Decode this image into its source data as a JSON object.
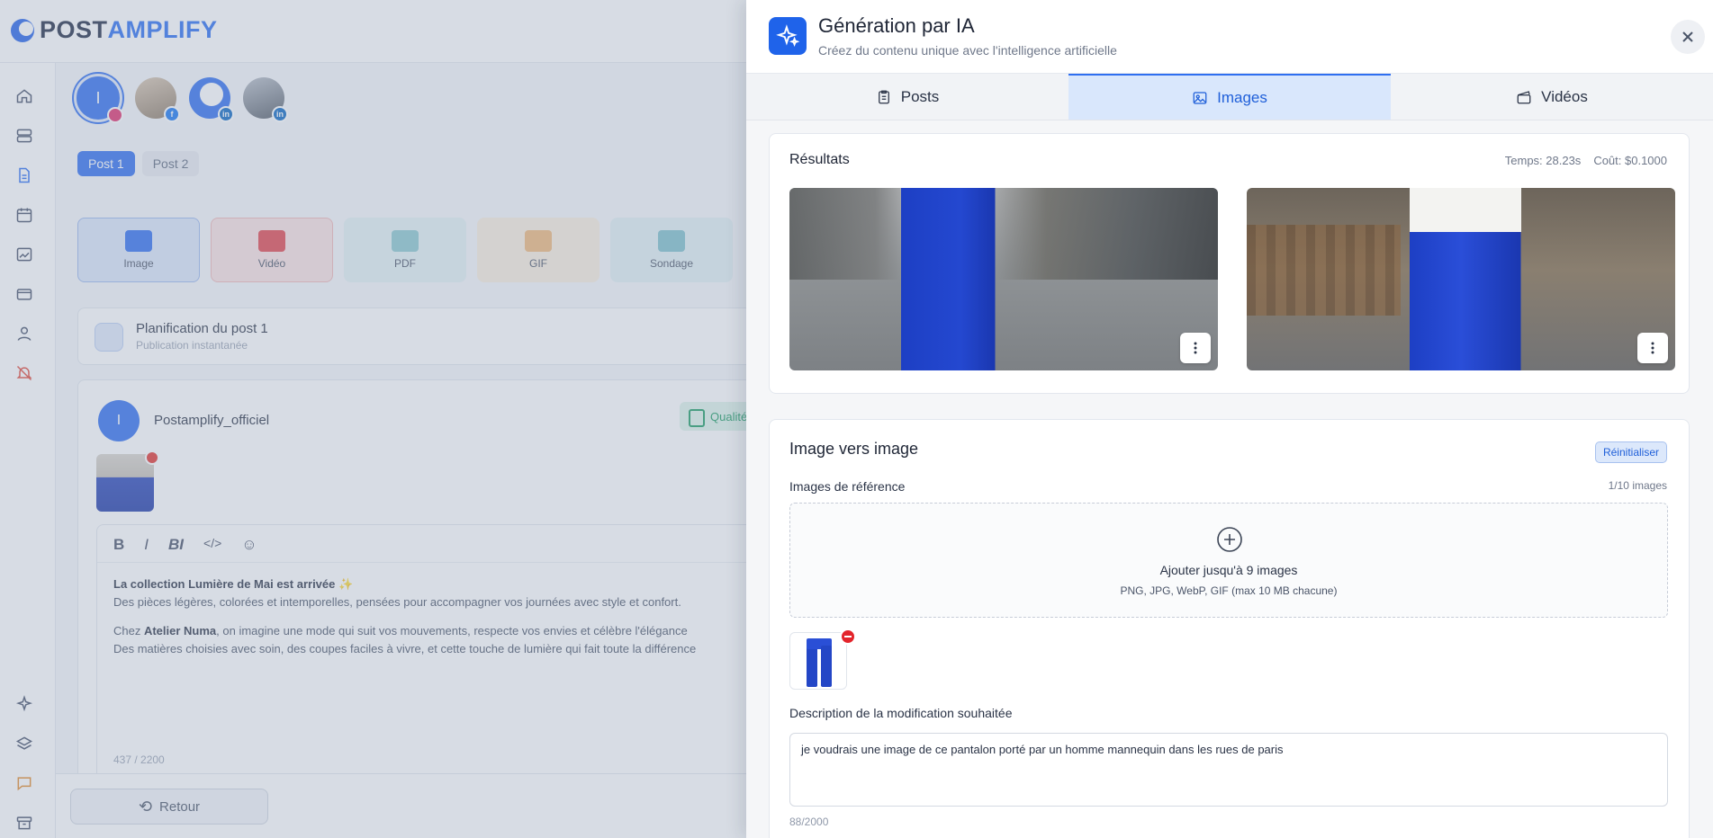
{
  "app": {
    "logo_post": "POST",
    "logo_amp": "AMPLIFY"
  },
  "accounts": {
    "primary_initial": "I"
  },
  "post_tabs": [
    "Post 1",
    "Post 2"
  ],
  "content_types": [
    "Image",
    "Vidéo",
    "PDF",
    "GIF",
    "Sondage"
  ],
  "planning": {
    "title": "Planification du post 1",
    "subtitle": "Publication instantanée"
  },
  "post": {
    "author_initial": "I",
    "author": "Postamplify_officiel",
    "quality_label": "Qualité",
    "toolbar": [
      "B",
      "I",
      "BI",
      "</>",
      "☺"
    ],
    "line1_bold": "La collection Lumière de Mai est arrivée ✨",
    "line2": "Des pièces légères, colorées et intemporelles, pensées pour accompagner vos journées avec style et confort.",
    "line3_pre": "Chez ",
    "line3_bold": "Atelier Numa",
    "line3_post": ", on imagine une mode qui suit vos mouvements, respecte vos envies et célèbre l'élégance",
    "line4": "Des matières choisies avec soin, des coupes faciles à vivre, et cette touche de lumière qui fait toute la différence",
    "counter": "437 / 2200"
  },
  "footer": {
    "back_label": "Retour"
  },
  "drawer": {
    "title": "Génération par IA",
    "subtitle": "Créez du contenu unique avec l'intelligence artificielle",
    "tabs": [
      {
        "label": "Posts",
        "icon": "clipboard-icon"
      },
      {
        "label": "Images",
        "icon": "image-icon",
        "active": true
      },
      {
        "label": "Vidéos",
        "icon": "clapper-icon"
      }
    ],
    "results": {
      "title": "Résultats",
      "time": "Temps: 28.23s",
      "cost": "Coût: $0.1000"
    },
    "img2img": {
      "title": "Image vers image",
      "reset_label": "Réinitialiser",
      "ref_label": "Images de référence",
      "ref_count": "1/10 images",
      "dropzone_text": "Ajouter jusqu'à 9 images",
      "dropzone_hint": "PNG, JPG, WebP, GIF (max 10 MB chacune)",
      "desc_label": "Description de la modification souhaitée",
      "desc_value": "je voudrais une image de ce pantalon porté par un homme mannequin dans les rues de paris",
      "char_count": "88/2000"
    }
  },
  "colors": {
    "brand": "#2b6ff2",
    "danger": "#e3242b"
  }
}
